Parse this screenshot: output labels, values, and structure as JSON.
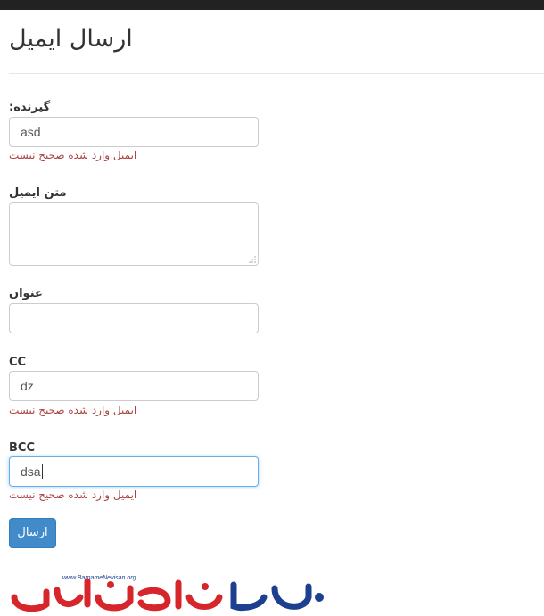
{
  "page": {
    "title": "ارسال ایمیل"
  },
  "form": {
    "recipient": {
      "label": ":گیرنده",
      "value": "asd",
      "error": "ایمیل وارد شده صحیح نیست"
    },
    "body": {
      "label": "متن ایمیل",
      "value": ""
    },
    "subject": {
      "label": "عنوان",
      "value": ""
    },
    "cc": {
      "label": "CC",
      "value": "dz",
      "error": "ایمیل وارد شده صحیح نیست"
    },
    "bcc": {
      "label": "BCC",
      "value": "dsa",
      "error": "ایمیل وارد شده صحیح نیست"
    },
    "submit_label": "ارسال"
  },
  "logo": {
    "url_text": "www.BarnameNevisan.org"
  },
  "colors": {
    "error": "#a94442",
    "primary": "#428bca",
    "focus": "#66afe9",
    "logo_red": "#d6252b",
    "logo_blue": "#1d3f8f"
  }
}
